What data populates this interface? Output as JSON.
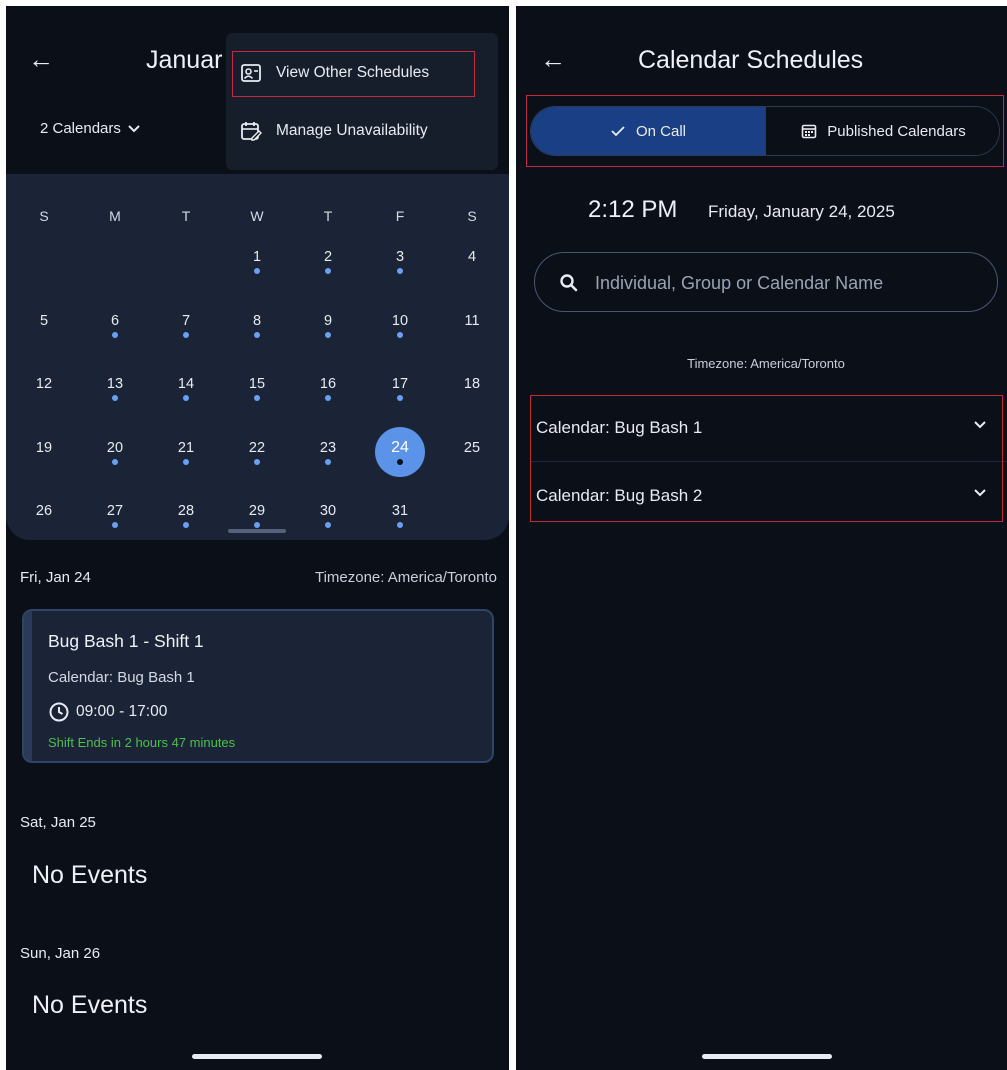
{
  "left": {
    "header": {
      "title": "Januar"
    },
    "menu": {
      "items": [
        {
          "label": "View Other Schedules",
          "icon": "person-card-icon"
        },
        {
          "label": "Manage Unavailability",
          "icon": "calendar-edit-icon"
        }
      ]
    },
    "calendar_selector": {
      "label": "2 Calendars"
    },
    "calendar": {
      "weekdays": [
        "S",
        "M",
        "T",
        "W",
        "T",
        "F",
        "S"
      ],
      "weeks": [
        [
          "",
          "",
          "",
          "1",
          "2",
          "3",
          "4"
        ],
        [
          "5",
          "6",
          "7",
          "8",
          "9",
          "10",
          "11"
        ],
        [
          "12",
          "13",
          "14",
          "15",
          "16",
          "17",
          "18"
        ],
        [
          "19",
          "20",
          "21",
          "22",
          "23",
          "24",
          "25"
        ],
        [
          "26",
          "27",
          "28",
          "29",
          "30",
          "31",
          ""
        ]
      ],
      "today": "24",
      "days_with_events": [
        "1",
        "2",
        "3",
        "6",
        "7",
        "8",
        "9",
        "10",
        "13",
        "14",
        "15",
        "16",
        "17",
        "20",
        "21",
        "22",
        "23",
        "24",
        "27",
        "28",
        "29",
        "30",
        "31"
      ]
    },
    "agenda": {
      "day1": "Fri, Jan 24",
      "timezone": "Timezone: America/Toronto",
      "event": {
        "title": "Bug Bash 1 - Shift 1",
        "calendar": "Calendar: Bug Bash 1",
        "time": "09:00 - 17:00",
        "ends": "Shift Ends in 2 hours 47 minutes"
      },
      "day2": "Sat, Jan 25",
      "day2_empty": "No Events",
      "day3": "Sun, Jan 26",
      "day3_empty": "No Events"
    }
  },
  "right": {
    "header": {
      "title": "Calendar Schedules"
    },
    "tabs": {
      "on_call": "On Call",
      "published": "Published Calendars",
      "selected": "On Call"
    },
    "clock": {
      "time": "2:12 PM",
      "date": "Friday, January 24, 2025"
    },
    "search": {
      "placeholder": "Individual, Group or Calendar Name",
      "value": ""
    },
    "timezone": "Timezone: America/Toronto",
    "calendars": [
      {
        "label": "Calendar: Bug Bash 1"
      },
      {
        "label": "Calendar: Bug Bash 2"
      }
    ]
  },
  "colors": {
    "background": "#0b0f18",
    "accent_blue": "#5b93e8",
    "highlight_red": "#c8283b",
    "shift_green": "#4cc04a"
  }
}
